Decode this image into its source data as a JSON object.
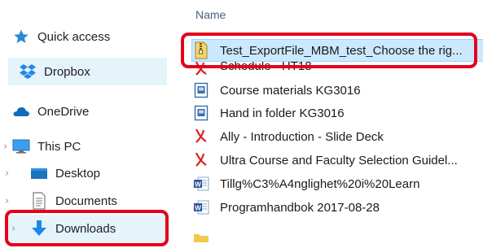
{
  "nav": {
    "items": [
      {
        "label": "Quick access",
        "icon": "star-icon"
      },
      {
        "label": "Dropbox",
        "icon": "dropbox-icon"
      },
      {
        "label": "OneDrive",
        "icon": "cloud-icon"
      },
      {
        "label": "This PC",
        "icon": "monitor-icon"
      },
      {
        "label": "Desktop",
        "icon": "desktop-folder-icon"
      },
      {
        "label": "Documents",
        "icon": "documents-icon"
      },
      {
        "label": "Downloads",
        "icon": "download-arrow-icon"
      }
    ]
  },
  "filelist": {
    "header": "Name",
    "rows": [
      {
        "label": "Test_ExportFile_MBM_test_Choose the rig...",
        "icon": "zip-file-icon"
      },
      {
        "label": "Schedule - HT18",
        "icon": "pdf-file-icon"
      },
      {
        "label": "Course materials KG3016",
        "icon": "shortcut-file-icon"
      },
      {
        "label": "Hand in folder KG3016",
        "icon": "shortcut-file-icon"
      },
      {
        "label": "Ally - Introduction - Slide Deck",
        "icon": "pdf-file-icon"
      },
      {
        "label": "Ultra Course and Faculty Selection Guidel...",
        "icon": "pdf-file-icon"
      },
      {
        "label": "Tillg%C3%A4nglighet%20i%20Learn",
        "icon": "word-file-icon"
      },
      {
        "label": "Programhandbok 2017-08-28",
        "icon": "word-file-icon"
      }
    ]
  },
  "colors": {
    "annotation": "#e3001b",
    "selection": "#cce8ff",
    "header_text": "#4c607a"
  }
}
